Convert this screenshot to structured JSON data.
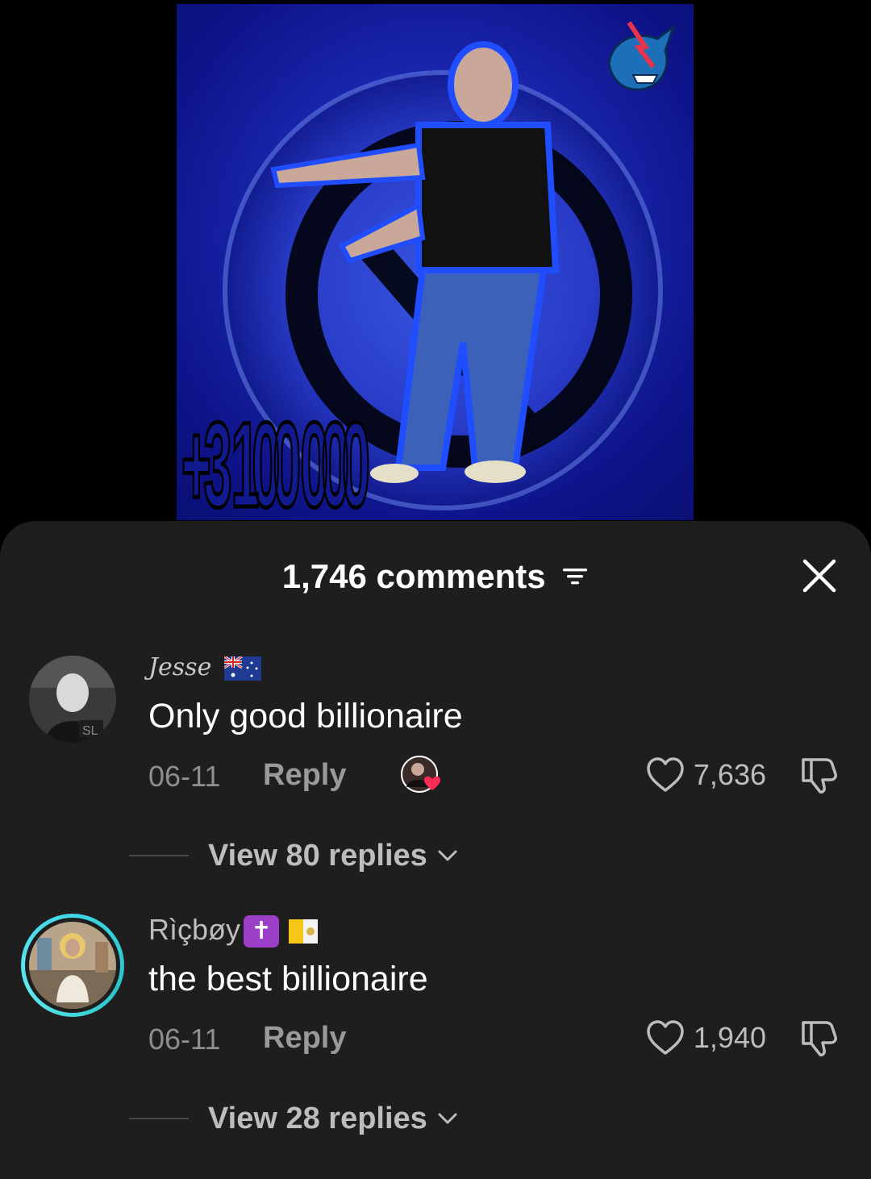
{
  "video": {
    "overlay_text": "+3 100 000",
    "logo_icon": "beast-mascot-logo"
  },
  "comments_sheet": {
    "title": "1,746 comments",
    "filter_icon": "filter-icon",
    "close_icon": "close-icon",
    "comments": [
      {
        "username": "Jesse",
        "username_flag": "australia-flag",
        "text": "Only good billionaire",
        "date": "06-11",
        "reply_label": "Reply",
        "creator_liked": true,
        "likes": "7,636",
        "view_replies": "View 80 replies"
      },
      {
        "username": "Rìçbøy",
        "username_emojis": [
          "latin-cross-emoji",
          "vatican-flag"
        ],
        "text": "the best billionaire",
        "date": "06-11",
        "reply_label": "Reply",
        "likes": "1,940",
        "view_replies": "View 28 replies"
      }
    ]
  },
  "colors": {
    "sheet_bg": "#1e1e1e",
    "video_bg": "#1a27b0",
    "ring_accent": "#3fd7e6",
    "like_badge": "#fe2c55"
  }
}
